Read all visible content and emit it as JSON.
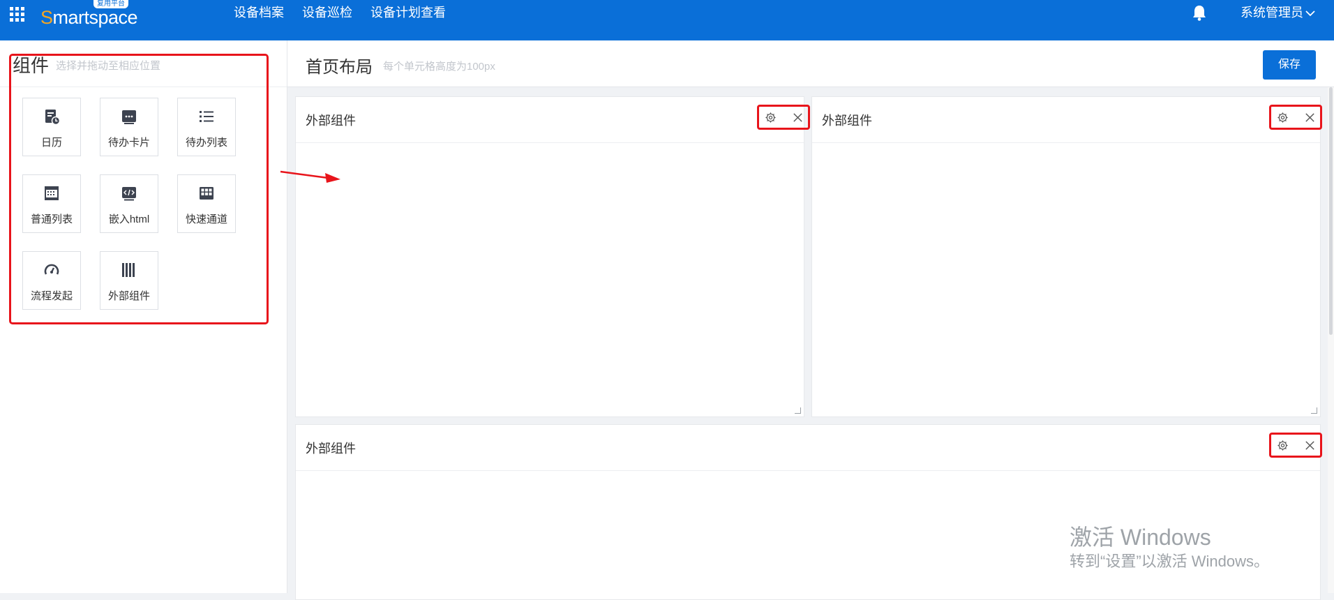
{
  "header": {
    "logo_text_first": "S",
    "logo_text_rest": "martspace",
    "logo_badge": "复用平台",
    "nav": [
      "设备档案",
      "设备巡检",
      "设备计划查看"
    ],
    "user": "系统管理员",
    "icons": [
      "apps-grid-icon",
      "bell-icon",
      "chevron-down-icon"
    ]
  },
  "left_panel": {
    "title": "组件",
    "hint": "选择并拖动至相应位置",
    "components": [
      {
        "label": "日历",
        "icon": "calendar-icon"
      },
      {
        "label": "待办卡片",
        "icon": "todo-card-icon"
      },
      {
        "label": "待办列表",
        "icon": "todo-list-icon"
      },
      {
        "label": "普通列表",
        "icon": "table-list-icon"
      },
      {
        "label": "嵌入html",
        "icon": "code-icon"
      },
      {
        "label": "快速通道",
        "icon": "quick-grid-icon"
      },
      {
        "label": "流程发起",
        "icon": "gauge-icon"
      },
      {
        "label": "外部组件",
        "icon": "barcode-icon"
      }
    ]
  },
  "main": {
    "title": "首页布局",
    "hint": "每个单元格高度为100px",
    "save_label": "保存",
    "widgets": [
      {
        "title": "外部组件"
      },
      {
        "title": "外部组件"
      },
      {
        "title": "外部组件"
      }
    ]
  },
  "watermark": {
    "line1": "激活 Windows",
    "line2": "转到“设置”以激活 Windows。"
  },
  "colors": {
    "header_bg": "#0a6fd8",
    "highlight": "#e8141b",
    "logo_accent": "#f5a623"
  }
}
